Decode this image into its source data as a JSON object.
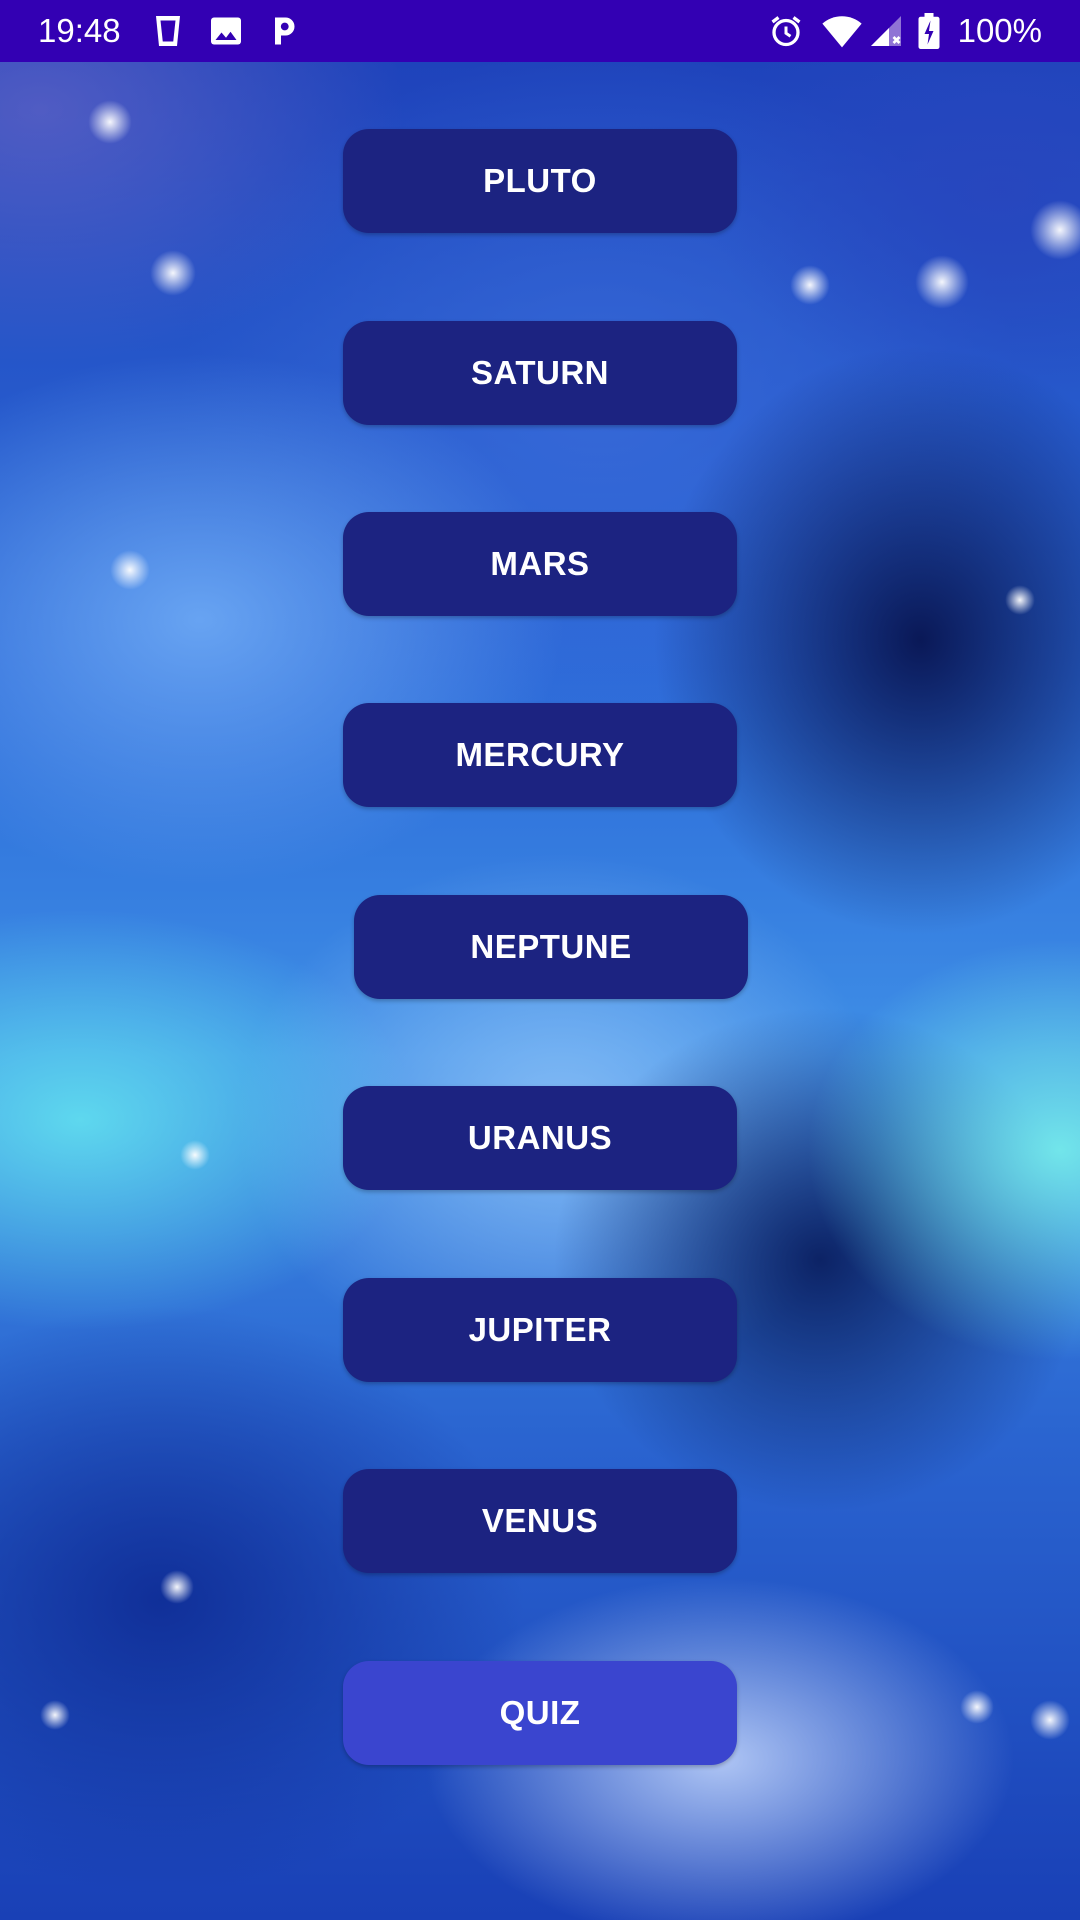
{
  "status_bar": {
    "time": "19:48",
    "battery": "100%",
    "background": "#3300b3",
    "left_icons": [
      "cup-icon",
      "image-icon",
      "parking-app-icon"
    ],
    "right_icons": [
      "alarm-icon",
      "wifi-icon",
      "cell-signal-icon",
      "battery-charging-icon"
    ]
  },
  "buttons": {
    "pluto": "PLUTO",
    "saturn": "SATURN",
    "mars": "MARS",
    "mercury": "MERCURY",
    "neptune": "NEPTUNE",
    "uranus": "URANUS",
    "jupiter": "JUPITER",
    "venus": "VENUS",
    "quiz": "QUIZ"
  },
  "colors": {
    "planet_button": "#1c2381",
    "quiz_button": "#3a45cf",
    "button_text": "#ffffff"
  }
}
